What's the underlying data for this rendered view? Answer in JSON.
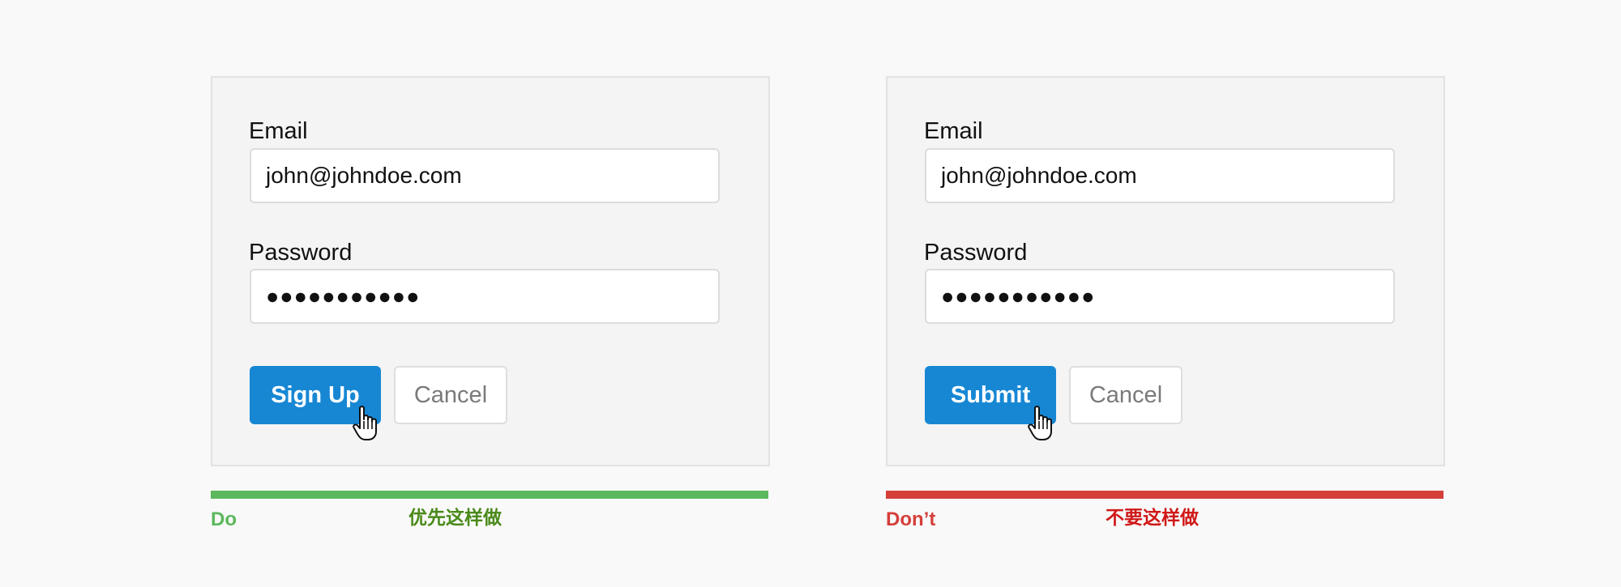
{
  "examples": [
    {
      "kind": "do",
      "email_label": "Email",
      "email_value": "john@johndoe.com",
      "password_label": "Password",
      "password_value": "●●●●●●●●●●●",
      "primary_button": "Sign Up",
      "secondary_button": "Cancel",
      "indicator_label": "Do",
      "note": "优先这样做",
      "accent_color": "#5cb85c"
    },
    {
      "kind": "dont",
      "email_label": "Email",
      "email_value": "john@johndoe.com",
      "password_label": "Password",
      "password_value": "●●●●●●●●●●●",
      "primary_button": "Submit",
      "secondary_button": "Cancel",
      "indicator_label": "Don’t",
      "note": "不要这样做",
      "accent_color": "#d43f3a"
    }
  ],
  "colors": {
    "primary_button": "#1787d4",
    "panel_background": "#f4f4f4",
    "page_background": "#f9f9f9"
  },
  "icons": {
    "cursor": "hand-pointer-icon"
  }
}
